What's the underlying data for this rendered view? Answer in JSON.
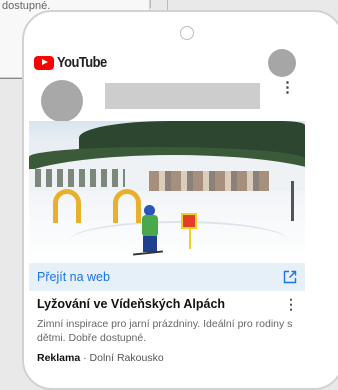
{
  "background": {
    "partial_text": "dostupné."
  },
  "header": {
    "logo_text": "YouTube",
    "brand_color": "#ff0000"
  },
  "ad": {
    "cta_label": "Přejít na web",
    "title": "Lyžování ve Vídeňských Alpách",
    "description": "Zimní inspirace pro jarní prázdniny. Ideální pro rodiny s dětmi. Dobře dostupné.",
    "sponsored_label": "Reklama",
    "separator": "·",
    "location": "Dolní Rakousko",
    "accent_color": "#1a73e8"
  }
}
